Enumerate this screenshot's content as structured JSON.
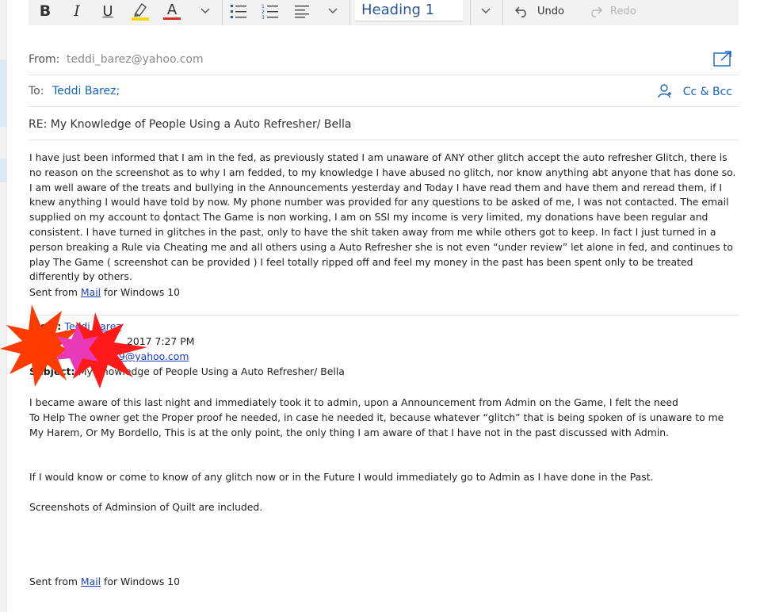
{
  "toolbar": {
    "bold_label": "B",
    "italic_label": "I",
    "underline_label": "U",
    "font_color_label": "A",
    "style_value": "Heading 1",
    "undo_label": "Undo",
    "redo_label": "Redo",
    "highlight_color": "#f5d90a",
    "font_color": "#d32f2f"
  },
  "header": {
    "from_label": "From:",
    "from_value": "teddi_barez@yahoo.com",
    "to_label": "To:",
    "to_value": "Teddi Barez;",
    "cc_bcc_label": "Cc & Bcc",
    "subject": "RE: My Knowledge of People Using a Auto Refresher/ Bella"
  },
  "body": {
    "paragraph": "I have just been informed that I am in the fed, as previously stated I am unaware of ANY other glitch accept the auto refresher Glitch, there is no reason on the screenshot as to why I am fedded, to my knowledge I have abused no glitch, nor know anything abt anyone that has done so. I am well aware of the treats and bullying in the Announcements yesterday and Today I have read them and have them and reread them, if I knew anything I would have told by now. My phone number was provided for any questions to be asked of me, I was not contacted. The email supplied on my account to contact The Game is non working, I am on SSI my income is very limited, my donations have been regular and consistent. I have turned in glitches in the past, only to have the shit taken away from me while others got to keep. In fact I just turned in a person breaking a Rule via Cheating me and all others using a Auto Refresher she is not even “under review” let alone in fed, and continues to play The Game ( screenshot can be provided ) I feel totally ripped off and feel my money in the past has been spent only to be treated differently by others.",
    "sent_prefix": "Sent from ",
    "sent_link": "Mail",
    "sent_suffix": " for Windows 10"
  },
  "quoted": {
    "from_label": "From: ",
    "from_value": "Teddi Barez",
    "sent_value": "2017 7:27 PM",
    "to_value": "9@yahoo.com",
    "subject_label": "Subject: ",
    "subject_value": "My Knowledge of People Using a Auto Refresher/ Bella",
    "paragraph": "I became aware of this last night and immediately took it to admin, upon a Announcement from Admin on the Game, I felt the need\nTo Help The owner get the Proper proof he needed, in case he needed it, because whatever “glitch” that is being spoken of is unaware to me\nMy Harem, Or My Bordello, This is at the only point, the only thing I am aware of that I have not in the past discussed with Admin.",
    "paragraph2": "If I would know or come to know of any glitch now or in the Future I would immediately go to Admin as I have done in the Past.",
    "paragraph3": "Screenshots of Adminsion of Quilt are included.",
    "sent_prefix": "Sent from ",
    "sent_link": "Mail",
    "sent_suffix": " for Windows 10"
  },
  "redaction": {
    "colors": [
      "#ff3b00",
      "#ff1a1a",
      "#e83ab8"
    ]
  }
}
